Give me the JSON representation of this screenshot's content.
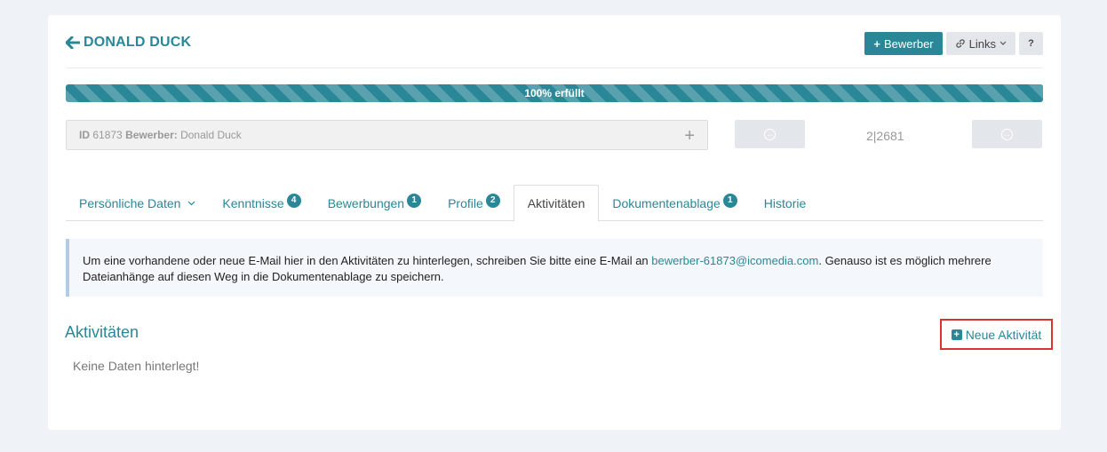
{
  "header": {
    "title": "DONALD DUCK",
    "buttons": {
      "bewerber": "Bewerber",
      "links": "Links",
      "help": "?"
    }
  },
  "progress": {
    "label": "100% erfüllt",
    "value": 100
  },
  "record": {
    "id_label": "ID",
    "id_value": "61873",
    "bewerber_label": "Bewerber:",
    "bewerber_value": "Donald Duck",
    "counter": "2|2681"
  },
  "tabs": [
    {
      "label": "Persönliche Daten",
      "badge": null
    },
    {
      "label": "Kenntnisse",
      "badge": "4"
    },
    {
      "label": "Bewerbungen",
      "badge": "1"
    },
    {
      "label": "Profile",
      "badge": "2"
    },
    {
      "label": "Aktivitäten",
      "badge": null
    },
    {
      "label": "Dokumentenablage",
      "badge": "1"
    },
    {
      "label": "Historie",
      "badge": null
    }
  ],
  "info": {
    "text_before": "Um eine vorhandene oder neue E-Mail hier in den Aktivitäten zu hinterlegen, schreiben Sie bitte eine E-Mail an ",
    "email": "bewerber-61873@icomedia.com",
    "text_after": ". Genauso ist es möglich mehrere Dateianhänge auf diesen Weg in die Dokumentenablage zu speichern."
  },
  "section": {
    "title": "Aktivitäten",
    "new_button": "Neue Aktivität",
    "empty": "Keine Daten hinterlegt!"
  },
  "colors": {
    "accent": "#2a8797",
    "highlight": "#d93232",
    "background": "#eff2f7"
  }
}
